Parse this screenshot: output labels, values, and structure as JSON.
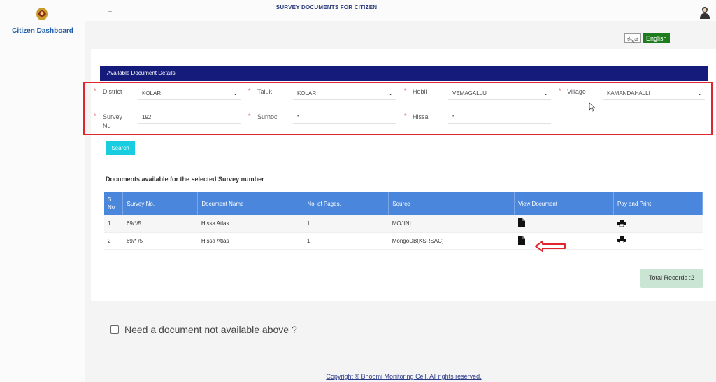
{
  "header": {
    "page_title": "SURVEY DOCUMENTS FOR CITIZEN",
    "languages": [
      "ಕನ್ನಡ",
      "English"
    ],
    "active_language": "English"
  },
  "sidebar": {
    "title": "Citizen Dashboard"
  },
  "panel": {
    "title": "Available Document Details"
  },
  "form": {
    "district": {
      "label": "District",
      "value": "KOLAR"
    },
    "taluk": {
      "label": "Taluk",
      "value": "KOLAR"
    },
    "hobli": {
      "label": "Hobli",
      "value": "VEMAGALLU"
    },
    "village": {
      "label": "Village",
      "value": "KAMANDAHALLI"
    },
    "survey_no": {
      "label_line1": "Survey",
      "label_line2": "No",
      "value": "192"
    },
    "surnoc": {
      "label": "Surnoc",
      "value": "*"
    },
    "hissa": {
      "label": "Hissa",
      "value": "*"
    },
    "search_label": "Search"
  },
  "documents": {
    "heading": "Documents available for the selected Survey number",
    "columns": [
      "S No",
      "Survey No.",
      "Document Name",
      "No. of Pages.",
      "Source",
      "View Document",
      "Pay and Print"
    ],
    "rows": [
      {
        "sno": "1",
        "survey_no": "69/*/5",
        "document_name": "Hissa Atlas",
        "pages": "1",
        "source": "MOJINI"
      },
      {
        "sno": "2",
        "survey_no": "69/* /5",
        "document_name": "Hissa Atlas",
        "pages": "1",
        "source": "MongoDB(KSRSAC)"
      }
    ],
    "total_records": "Total Records :2"
  },
  "request": {
    "label": "Need a document not available above ?"
  },
  "footer": {
    "copyright": "Copyright © Bhoomi Monitoring Cell. All rights reserved."
  },
  "colors": {
    "panel_header": "#141b7b",
    "table_header": "#4a86dc",
    "search_button": "#18cde0",
    "highlight": "#e0252f",
    "english_active": "#1e7b1e"
  },
  "icons": [
    "emblem-icon",
    "hamburger-icon",
    "user-icon",
    "chevron-down-icon",
    "document-icon",
    "printer-icon",
    "arrow-left-icon",
    "mouse-cursor-icon"
  ]
}
